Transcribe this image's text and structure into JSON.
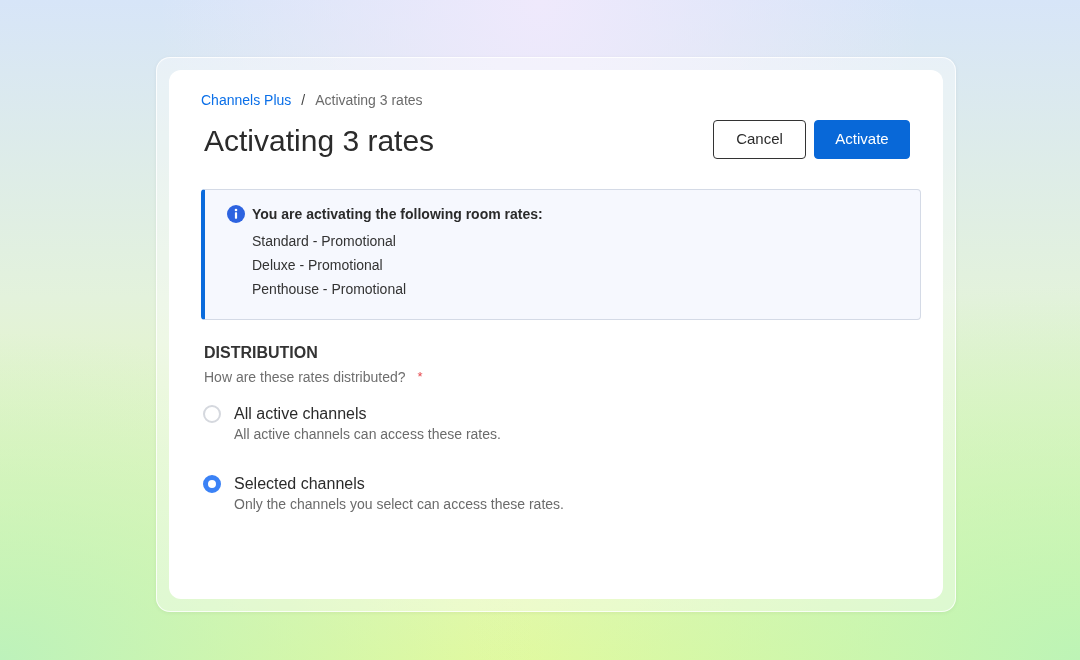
{
  "breadcrumb": {
    "items": [
      {
        "label": "Channels Plus",
        "kind": "link"
      },
      {
        "label": "Activating 3 rates",
        "kind": "current"
      }
    ],
    "separator": "/"
  },
  "title": "Activating 3 rates",
  "buttons": [
    {
      "label": "Cancel",
      "kind": "secondary"
    },
    {
      "label": "Activate",
      "kind": "primary"
    }
  ],
  "notice": {
    "heading": "You are activating the following room rates:",
    "items": [
      "Standard - Promotional",
      "Deluxe - Promotional",
      "Penthouse - Promotional"
    ]
  },
  "distribution": {
    "heading": "DISTRIBUTION",
    "question": "How are these rates distributed?",
    "required_mark": "*",
    "options": [
      {
        "label": "All active channels",
        "description": "All active channels can access these rates.",
        "selected": false
      },
      {
        "label": "Selected channels",
        "description": "Only the channels you select can access these rates.",
        "selected": true
      }
    ]
  }
}
